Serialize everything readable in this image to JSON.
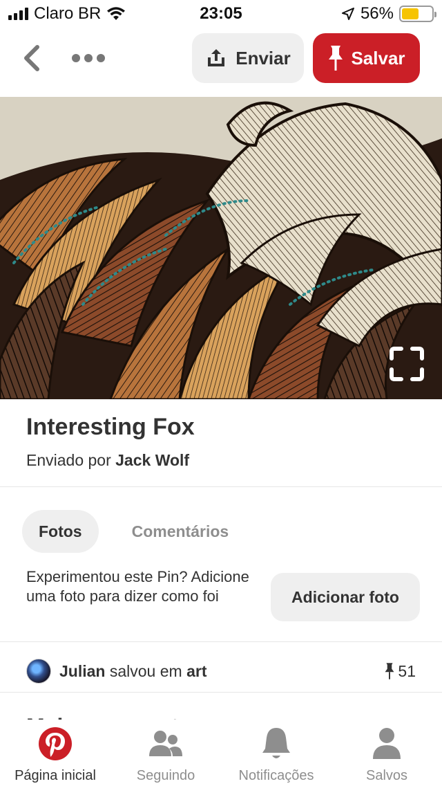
{
  "status_bar": {
    "carrier": "Claro BR",
    "time": "23:05",
    "battery": "56%",
    "battery_level": 0.56
  },
  "toolbar": {
    "back_icon": "chevron-left-icon",
    "more_icon": "ellipsis-icon",
    "send_label": "Enviar",
    "send_icon": "share-upload-icon",
    "save_label": "Salvar",
    "save_icon": "pushpin-icon",
    "save_color": "#cb1f27"
  },
  "pin": {
    "title": "Interesting Fox",
    "sent_by_prefix": "Enviado por",
    "author": "Jack Wolf",
    "lens_icon": "visual-search-icon"
  },
  "tabs": [
    {
      "label": "Fotos",
      "active": true
    },
    {
      "label": "Comentários",
      "active": false
    }
  ],
  "try_pin": {
    "text": "Experimentou este Pin? Adicione uma foto para dizer como foi",
    "button": "Adicionar foto"
  },
  "saved": {
    "user": "Julian",
    "action": "salvou em",
    "board": "art",
    "count": "51"
  },
  "more_like_this": "Mais como este",
  "bottom_nav": [
    {
      "label": "Página inicial",
      "icon": "pinterest-logo-icon",
      "active": true
    },
    {
      "label": "Seguindo",
      "icon": "people-icon",
      "active": false
    },
    {
      "label": "Notificações",
      "icon": "bell-icon",
      "active": false
    },
    {
      "label": "Salvos",
      "icon": "person-icon",
      "active": false
    }
  ]
}
